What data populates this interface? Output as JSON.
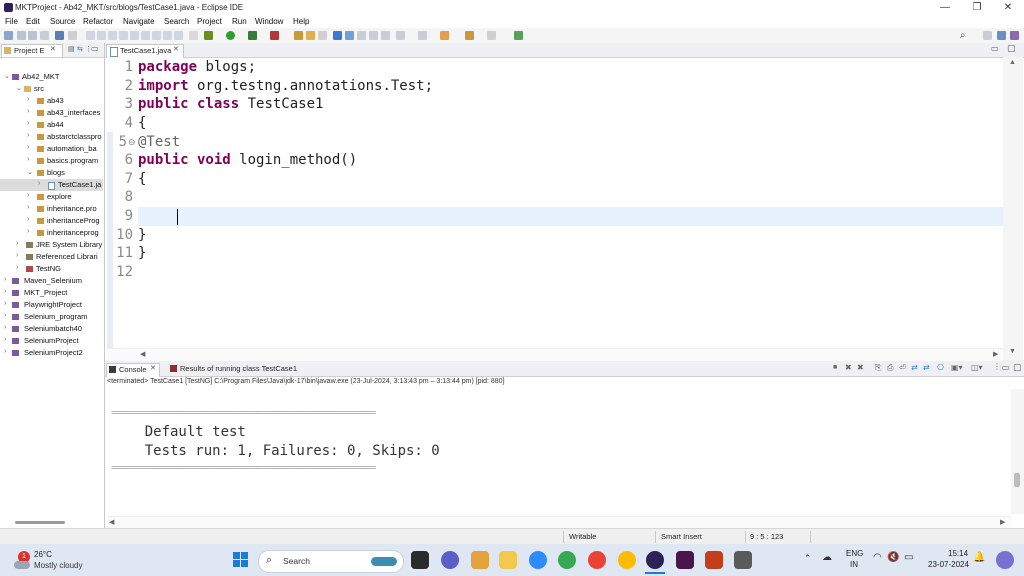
{
  "window": {
    "title": "MKTProject - Ab42_MKT/src/blogs/TestCase1.java - Eclipse IDE",
    "minimize": "—",
    "maximize": "❐",
    "close": "✕"
  },
  "menu": [
    "File",
    "Edit",
    "Source",
    "Refactor",
    "Navigate",
    "Search",
    "Project",
    "Run",
    "Window",
    "Help"
  ],
  "project_explorer": {
    "tab_label": "Project E",
    "items": [
      {
        "label": "Ab42_MKT",
        "icon": "project-icon"
      },
      {
        "label": "src",
        "icon": "source-folder-icon"
      },
      {
        "label": "ab43",
        "icon": "package-icon"
      },
      {
        "label": "ab43_interfaces",
        "icon": "package-icon"
      },
      {
        "label": "ab44",
        "icon": "package-icon"
      },
      {
        "label": "abstarctclasspro",
        "icon": "package-icon"
      },
      {
        "label": "automation_ba",
        "icon": "package-icon"
      },
      {
        "label": "basics.program",
        "icon": "package-icon"
      },
      {
        "label": "blogs",
        "icon": "package-icon"
      },
      {
        "label": "TestCase1.ja",
        "icon": "java-file-icon"
      },
      {
        "label": "explore",
        "icon": "package-icon"
      },
      {
        "label": "inheritance.pro",
        "icon": "package-icon"
      },
      {
        "label": "inheritanceProg",
        "icon": "package-icon"
      },
      {
        "label": "inheritanceprog",
        "icon": "package-icon"
      },
      {
        "label": "JRE System Library",
        "icon": "library-icon"
      },
      {
        "label": "Referenced Librari",
        "icon": "library-icon"
      },
      {
        "label": "TestNG",
        "icon": "library-icon"
      },
      {
        "label": "Maven_Selenium",
        "icon": "project-icon"
      },
      {
        "label": "MKT_Project",
        "icon": "project-icon"
      },
      {
        "label": "PlaywrightProject",
        "icon": "project-icon"
      },
      {
        "label": "Selenium_program",
        "icon": "project-icon"
      },
      {
        "label": "Seleniumbatch40",
        "icon": "project-icon"
      },
      {
        "label": "SeleniumProject",
        "icon": "project-icon"
      },
      {
        "label": "SeleniumProject2",
        "icon": "project-icon"
      }
    ]
  },
  "editor": {
    "tab_label": "TestCase1.java",
    "line_numbers": [
      "1",
      "2",
      "3",
      "4",
      "5",
      "6",
      "7",
      "8",
      "9",
      "10",
      "11",
      "12"
    ],
    "fold_marker": "⊖",
    "code": {
      "l1_kw": "package",
      "l1_rest": " blogs;",
      "l2_kw": "import",
      "l2_rest": " org.testng.annotations.Test;",
      "l3_kw": "public class",
      "l3_rest": " TestCase1",
      "l4": "{",
      "l5": "@Test",
      "l6_kw": "public void",
      "l6_rest": " login_method()",
      "l7": "{",
      "l8": "",
      "l9": "",
      "l10": "}",
      "l11": "}",
      "l12": ""
    }
  },
  "console": {
    "tab_console": "Console",
    "tab_results": "Results of running class TestCase1",
    "status": "<terminated> TestCase1 [TestNG] C:\\Program Files\\Java\\jdk-17\\bin\\javaw.exe  (23-Jul-2024, 3:13:43 pm – 3:13:44 pm) [pid: 880]",
    "separator": "===============================================",
    "line1": "    Default test",
    "line2": "    Tests run: 1, Failures: 0, Skips: 0"
  },
  "statusbar": {
    "writable": "Writable",
    "insert_mode": "Smart Insert",
    "position": "9 : 5 : 123"
  },
  "taskbar": {
    "weather_temp": "26°C",
    "weather_desc": "Mostly cloudy",
    "weather_badge": "1",
    "search_placeholder": "Search",
    "lang_top": "ENG",
    "lang_bottom": "IN",
    "time": "15:14",
    "date": "23-07-2024"
  },
  "colors": {
    "keyword": "#7f0055",
    "annotation": "#646464",
    "current_line": "#e8f2fe"
  }
}
